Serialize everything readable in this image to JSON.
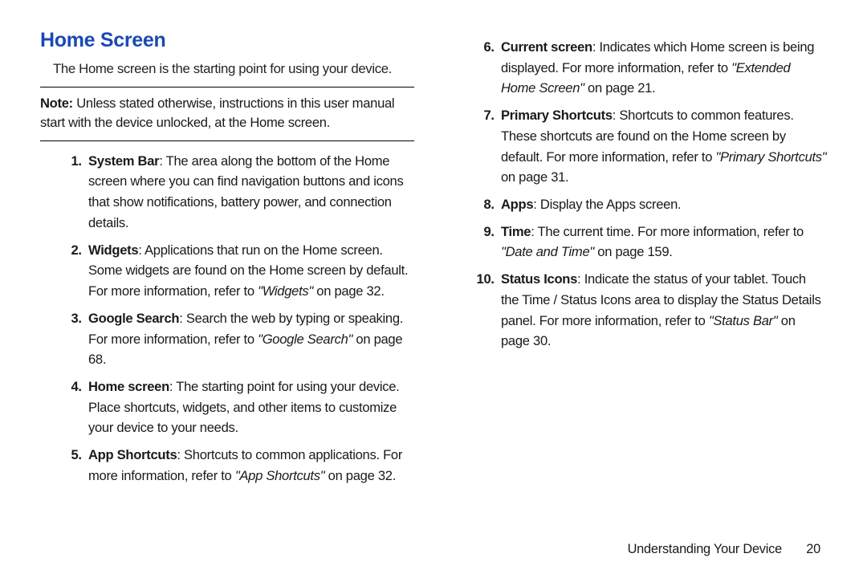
{
  "heading": "Home Screen",
  "intro": "The Home screen is the starting point for using your device.",
  "note": {
    "label": "Note:",
    "text": " Unless stated otherwise, instructions in this user manual start with the device unlocked, at the Home screen."
  },
  "left_items": [
    {
      "num": "1.",
      "term": "System Bar",
      "body": ": The area along the bottom of the Home screen where you can find navigation buttons and icons that show notifications, battery power, and connection details.",
      "ref": "",
      "tail": ""
    },
    {
      "num": "2.",
      "term": "Widgets",
      "body": ": Applications that run on the Home screen. Some widgets are found on the Home screen by default. For more information, refer to ",
      "ref": "\"Widgets\"",
      "tail": " on page 32."
    },
    {
      "num": "3.",
      "term": "Google Search",
      "body": ": Search the web by typing or speaking. For more information, refer to ",
      "ref": "\"Google Search\"",
      "tail": " on page 68."
    },
    {
      "num": "4.",
      "term": "Home screen",
      "body": ": The starting point for using your device. Place shortcuts, widgets, and other items to customize your device to your needs.",
      "ref": "",
      "tail": ""
    },
    {
      "num": "5.",
      "term": "App Shortcuts",
      "body": ": Shortcuts to common applications. For more information, refer to ",
      "ref": "\"App Shortcuts\"",
      "tail": " on page 32."
    }
  ],
  "right_items": [
    {
      "num": "6.",
      "term": "Current screen",
      "body": ": Indicates which Home screen is being displayed. For more information, refer to ",
      "ref": "\"Extended Home Screen\"",
      "tail": " on page 21."
    },
    {
      "num": "7.",
      "term": "Primary Shortcuts",
      "body": ": Shortcuts to common features. These shortcuts are found on the Home screen by default. For more information, refer to ",
      "ref": "\"Primary Shortcuts\"",
      "tail": " on page 31."
    },
    {
      "num": "8.",
      "term": "Apps",
      "body": ": Display the Apps screen.",
      "ref": "",
      "tail": ""
    },
    {
      "num": "9.",
      "term": "Time",
      "body": ": The current time. For more information, refer to ",
      "ref": "\"Date and Time\"",
      "tail": " on page 159."
    },
    {
      "num": "10.",
      "term": "Status Icons",
      "body": ": Indicate the status of your tablet. Touch the Time / Status Icons area to display the Status Details panel. For more information, refer to ",
      "ref": "\"Status Bar\"",
      "tail": " on page 30."
    }
  ],
  "footer": {
    "section": "Understanding Your Device",
    "page": "20"
  }
}
